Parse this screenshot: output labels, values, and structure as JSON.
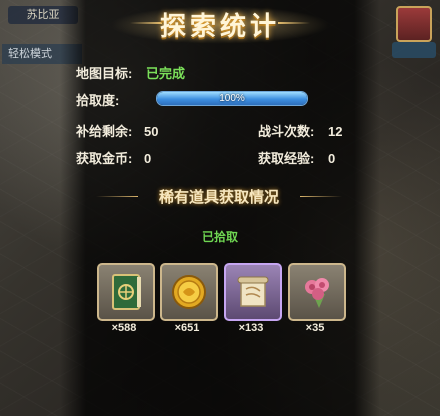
{
  "background": {
    "left_tag": "苏比亚",
    "mode_tag": "轻松模式"
  },
  "title": "探索统计",
  "stats": {
    "map_goal_label": "地图目标:",
    "map_goal_value": "已完成",
    "pickup_label": "拾取度:",
    "pickup_value": "100%",
    "pickup_fraction": 1.0,
    "supply_label": "补给剩余:",
    "supply_value": "50",
    "battle_label": "战斗次数:",
    "battle_value": "12",
    "gold_label": "获取金币:",
    "gold_value": "0",
    "exp_label": "获取经验:",
    "exp_value": "0"
  },
  "rare_section": {
    "title": "稀有道具获取情况",
    "status": "已拾取",
    "items": [
      {
        "icon": "green-book-icon",
        "count": "×588",
        "rarity": "gold"
      },
      {
        "icon": "gold-coin-icon",
        "count": "×651",
        "rarity": "gold"
      },
      {
        "icon": "scroll-icon",
        "count": "×133",
        "rarity": "purple"
      },
      {
        "icon": "rose-bouquet-icon",
        "count": "×35",
        "rarity": "gold"
      }
    ]
  },
  "colors": {
    "accent_green": "#7be05a",
    "title_gold": "#f0b040",
    "progress_blue": "#3d8fe0"
  }
}
